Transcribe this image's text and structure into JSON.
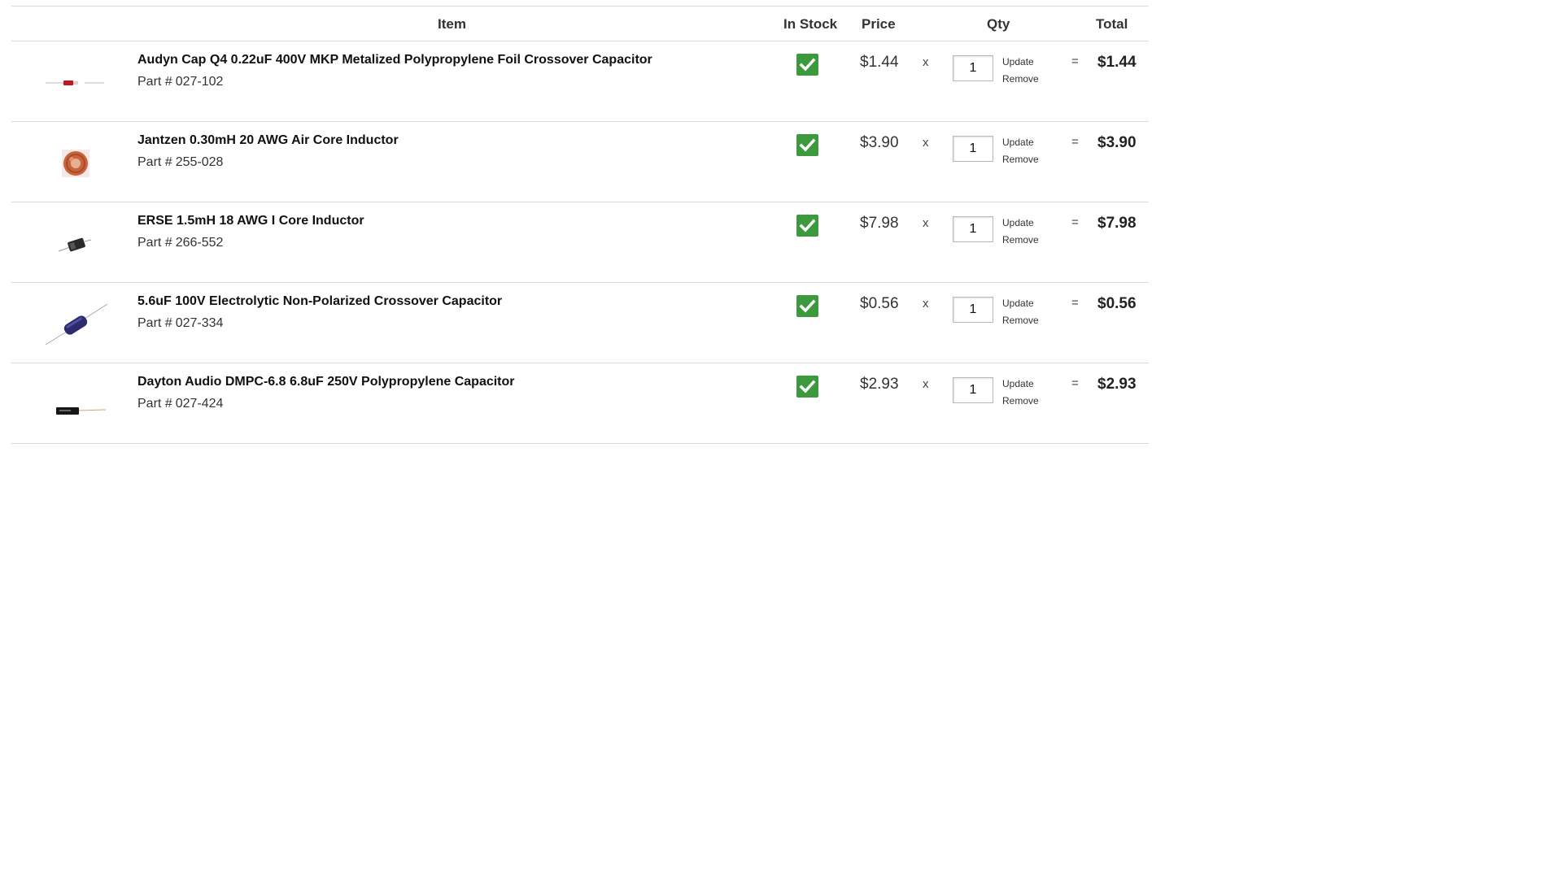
{
  "header": {
    "item": "Item",
    "in_stock": "In Stock",
    "price": "Price",
    "qty": "Qty",
    "total": "Total"
  },
  "labels": {
    "part_prefix": "Part #",
    "times": "x",
    "equals": "=",
    "update": "Update",
    "remove": "Remove"
  },
  "colors": {
    "in_stock_badge": "#3c9a3c",
    "divider": "#d9d9d9"
  },
  "items": [
    {
      "name": "Audyn Cap Q4 0.22uF 400V MKP Metalized Polypropylene Foil Crossover Capacitor",
      "part": "027-102",
      "in_stock": true,
      "price": "$1.44",
      "qty": "1",
      "total": "$1.44",
      "thumb_icon": "film-capacitor-icon"
    },
    {
      "name": "Jantzen 0.30mH 20 AWG Air Core Inductor",
      "part": "255-028",
      "in_stock": true,
      "price": "$3.90",
      "qty": "1",
      "total": "$3.90",
      "thumb_icon": "air-core-inductor-icon"
    },
    {
      "name": "ERSE 1.5mH 18 AWG I Core Inductor",
      "part": "266-552",
      "in_stock": true,
      "price": "$7.98",
      "qty": "1",
      "total": "$7.98",
      "thumb_icon": "i-core-inductor-icon"
    },
    {
      "name": "5.6uF 100V Electrolytic Non-Polarized Crossover Capacitor",
      "part": "027-334",
      "in_stock": true,
      "price": "$0.56",
      "qty": "1",
      "total": "$0.56",
      "thumb_icon": "electrolytic-capacitor-icon"
    },
    {
      "name": "Dayton Audio DMPC-6.8 6.8uF 250V Polypropylene Capacitor",
      "part": "027-424",
      "in_stock": true,
      "price": "$2.93",
      "qty": "1",
      "total": "$2.93",
      "thumb_icon": "polypropylene-capacitor-icon"
    }
  ]
}
